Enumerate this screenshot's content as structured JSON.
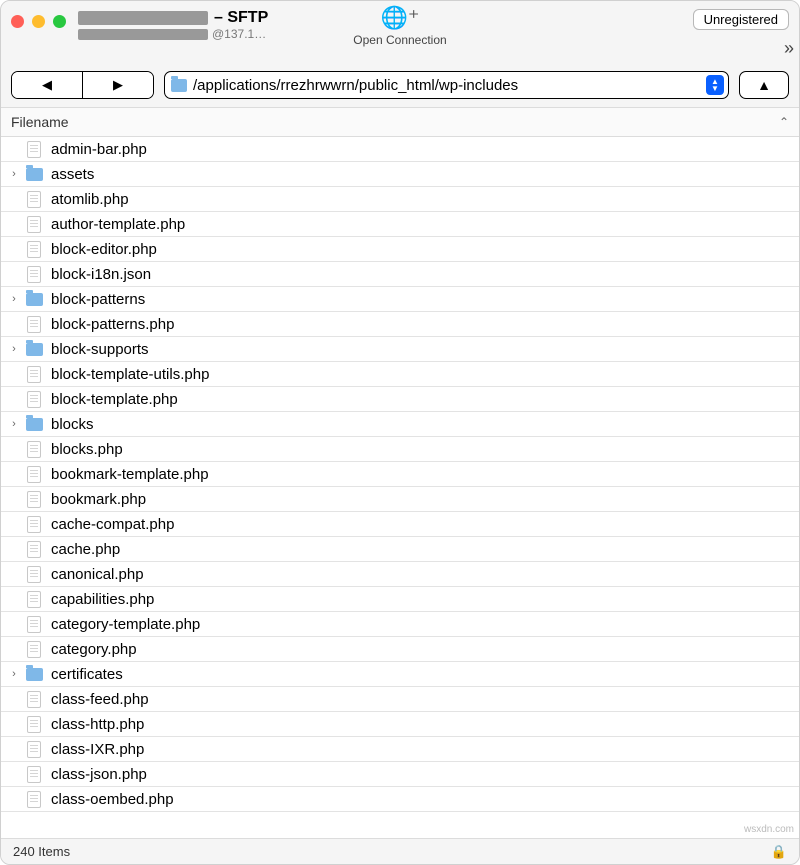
{
  "titlebar": {
    "title_suffix": "– SFTP",
    "subtitle_suffix": "@137.1…",
    "open_connection": "Open Connection",
    "unregistered": "Unregistered"
  },
  "toolbar": {
    "path": "/applications/rrezhrwwrn/public_html/wp-includes"
  },
  "column_header": "Filename",
  "rows": [
    {
      "name": "admin-bar.php",
      "type": "file"
    },
    {
      "name": "assets",
      "type": "folder"
    },
    {
      "name": "atomlib.php",
      "type": "file"
    },
    {
      "name": "author-template.php",
      "type": "file"
    },
    {
      "name": "block-editor.php",
      "type": "file"
    },
    {
      "name": "block-i18n.json",
      "type": "file"
    },
    {
      "name": "block-patterns",
      "type": "folder"
    },
    {
      "name": "block-patterns.php",
      "type": "file"
    },
    {
      "name": "block-supports",
      "type": "folder"
    },
    {
      "name": "block-template-utils.php",
      "type": "file"
    },
    {
      "name": "block-template.php",
      "type": "file"
    },
    {
      "name": "blocks",
      "type": "folder"
    },
    {
      "name": "blocks.php",
      "type": "file"
    },
    {
      "name": "bookmark-template.php",
      "type": "file"
    },
    {
      "name": "bookmark.php",
      "type": "file"
    },
    {
      "name": "cache-compat.php",
      "type": "file"
    },
    {
      "name": "cache.php",
      "type": "file"
    },
    {
      "name": "canonical.php",
      "type": "file"
    },
    {
      "name": "capabilities.php",
      "type": "file"
    },
    {
      "name": "category-template.php",
      "type": "file"
    },
    {
      "name": "category.php",
      "type": "file"
    },
    {
      "name": "certificates",
      "type": "folder"
    },
    {
      "name": "class-feed.php",
      "type": "file"
    },
    {
      "name": "class-http.php",
      "type": "file"
    },
    {
      "name": "class-IXR.php",
      "type": "file"
    },
    {
      "name": "class-json.php",
      "type": "file"
    },
    {
      "name": "class-oembed.php",
      "type": "file"
    }
  ],
  "status": {
    "items": "240 Items"
  },
  "watermark": "wsxdn.com"
}
